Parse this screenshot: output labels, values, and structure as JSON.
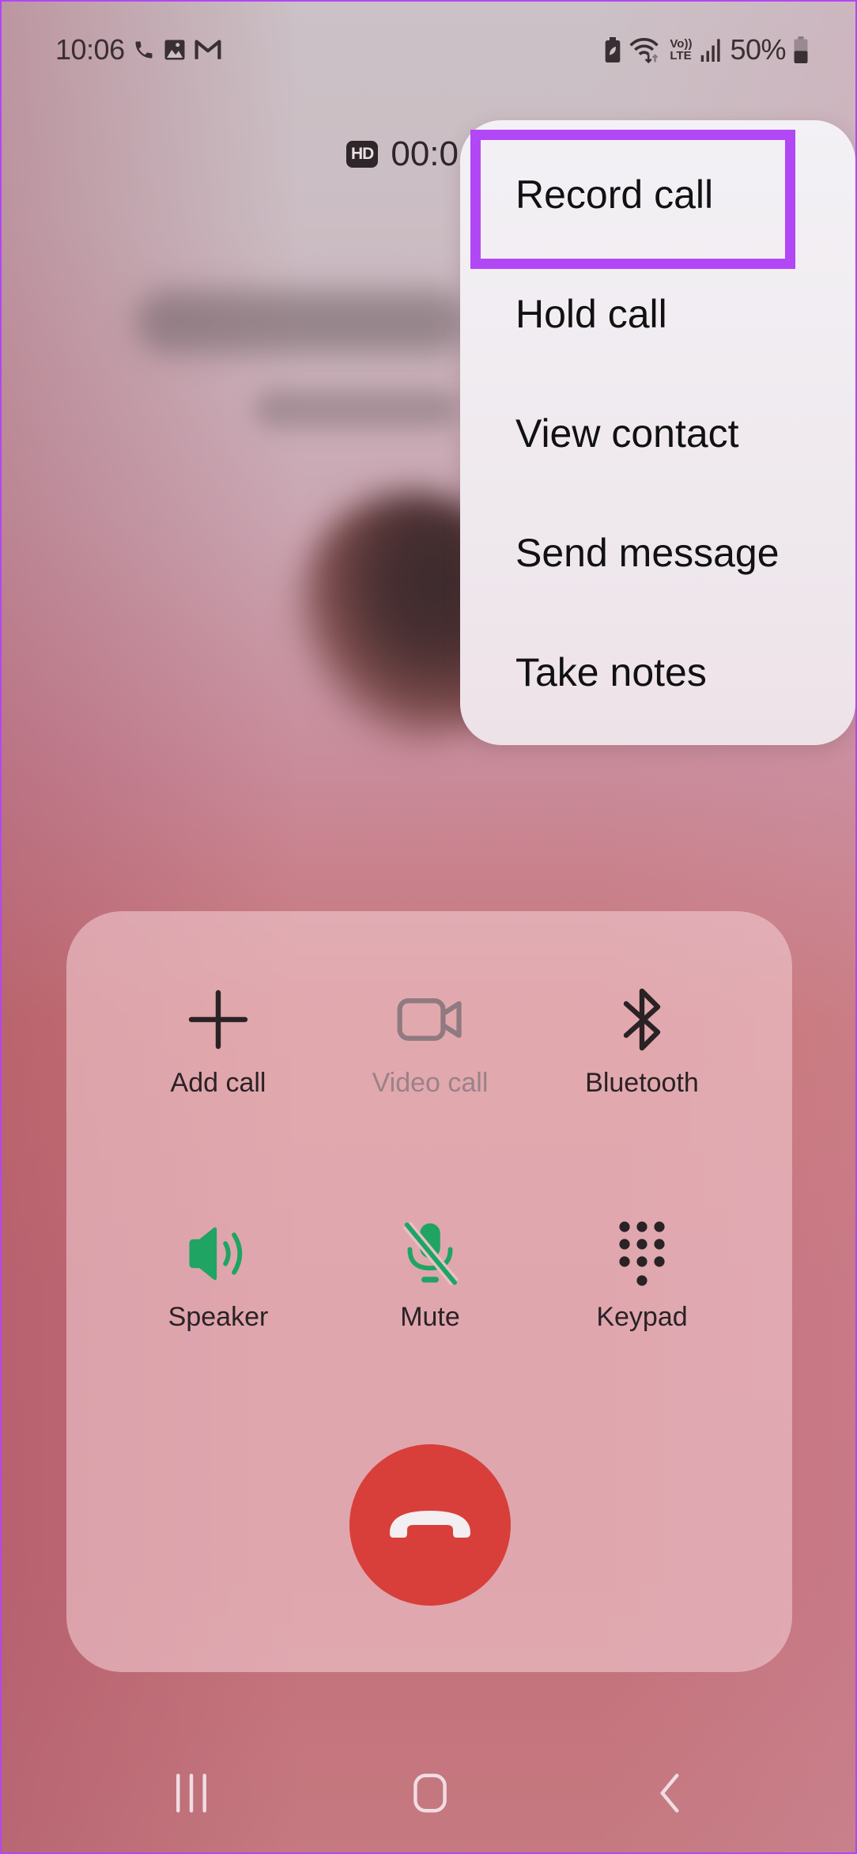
{
  "status_bar": {
    "time": "10:06",
    "notification_icons": [
      "phone-icon",
      "gallery-icon",
      "gmail-icon"
    ],
    "system_icons": [
      "battery-saver-icon",
      "wifi-icon",
      "volte-icon",
      "signal-icon"
    ],
    "volte_top": "Vo))",
    "volte_bottom": "LTE",
    "battery_percent": "50%",
    "battery_level": 0.5
  },
  "call": {
    "hd_badge": "HD",
    "timer_visible": "00:0",
    "contact_name_blurred": true,
    "contact_number_blurred": true
  },
  "menu": {
    "items": [
      {
        "label": "Record call",
        "highlighted": true
      },
      {
        "label": "Hold call"
      },
      {
        "label": "View contact"
      },
      {
        "label": "Send message"
      },
      {
        "label": "Take notes"
      }
    ],
    "highlight_color": "#b147f5"
  },
  "controls": [
    {
      "label": "Add call",
      "icon": "plus-icon",
      "enabled": true
    },
    {
      "label": "Video call",
      "icon": "video-camera-icon",
      "enabled": false
    },
    {
      "label": "Bluetooth",
      "icon": "bluetooth-icon",
      "enabled": true
    },
    {
      "label": "Speaker",
      "icon": "speaker-icon",
      "enabled": true,
      "active": true
    },
    {
      "label": "Mute",
      "icon": "mic-off-icon",
      "enabled": true,
      "active": true
    },
    {
      "label": "Keypad",
      "icon": "keypad-icon",
      "enabled": true
    }
  ],
  "colors": {
    "active_green": "#1fa463",
    "end_call_red": "#d83f3a",
    "frame_accent": "#b147f5"
  },
  "nav": {
    "buttons": [
      "recent-apps",
      "home",
      "back"
    ]
  }
}
